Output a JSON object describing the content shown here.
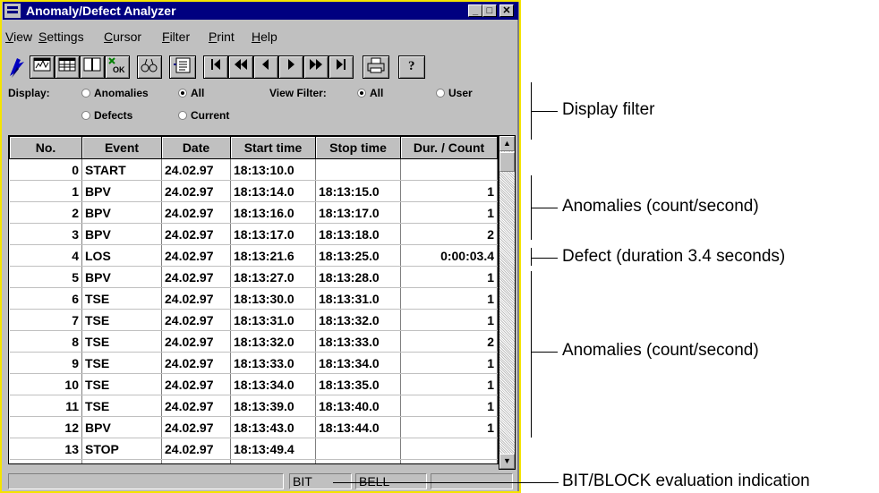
{
  "window": {
    "title": "Anomaly/Defect Analyzer"
  },
  "title_buttons": [
    "_",
    "□",
    "✕"
  ],
  "menu": [
    "View",
    "Settings",
    "Cursor",
    "Filter",
    "Print",
    "Help"
  ],
  "toolbar": {
    "icons": [
      "app-logo-icon",
      "chart-icon",
      "table-icon",
      "split-view-icon",
      "ok-icon",
      "find-icon",
      "list-icon",
      "first-icon",
      "rewind-icon",
      "prev-icon",
      "next-icon",
      "fast-forward-icon",
      "last-icon",
      "print-icon",
      "help-icon"
    ]
  },
  "filter": {
    "display_label": "Display:",
    "view_filter_label": "View Filter:",
    "display_options": [
      {
        "label": "Anomalies",
        "checked": false
      },
      {
        "label": "All",
        "checked": true
      },
      {
        "label": "Defects",
        "checked": false
      },
      {
        "label": "Current",
        "checked": false
      }
    ],
    "view_options": [
      {
        "label": "All",
        "checked": true
      },
      {
        "label": "User",
        "checked": false
      }
    ]
  },
  "table": {
    "columns": [
      "No.",
      "Event",
      "Date",
      "Start time",
      "Stop time",
      "Dur. / Count"
    ],
    "rows": [
      [
        "0",
        "START",
        "24.02.97",
        "18:13:10.0",
        "",
        ""
      ],
      [
        "1",
        "BPV",
        "24.02.97",
        "18:13:14.0",
        "18:13:15.0",
        "1"
      ],
      [
        "2",
        "BPV",
        "24.02.97",
        "18:13:16.0",
        "18:13:17.0",
        "1"
      ],
      [
        "3",
        "BPV",
        "24.02.97",
        "18:13:17.0",
        "18:13:18.0",
        "2"
      ],
      [
        "4",
        "LOS",
        "24.02.97",
        "18:13:21.6",
        "18:13:25.0",
        "0:00:03.4"
      ],
      [
        "5",
        "BPV",
        "24.02.97",
        "18:13:27.0",
        "18:13:28.0",
        "1"
      ],
      [
        "6",
        "TSE",
        "24.02.97",
        "18:13:30.0",
        "18:13:31.0",
        "1"
      ],
      [
        "7",
        "TSE",
        "24.02.97",
        "18:13:31.0",
        "18:13:32.0",
        "1"
      ],
      [
        "8",
        "TSE",
        "24.02.97",
        "18:13:32.0",
        "18:13:33.0",
        "2"
      ],
      [
        "9",
        "TSE",
        "24.02.97",
        "18:13:33.0",
        "18:13:34.0",
        "1"
      ],
      [
        "10",
        "TSE",
        "24.02.97",
        "18:13:34.0",
        "18:13:35.0",
        "1"
      ],
      [
        "11",
        "TSE",
        "24.02.97",
        "18:13:39.0",
        "18:13:40.0",
        "1"
      ],
      [
        "12",
        "BPV",
        "24.02.97",
        "18:13:43.0",
        "18:13:44.0",
        "1"
      ],
      [
        "13",
        "STOP",
        "24.02.97",
        "18:13:49.4",
        "",
        ""
      ],
      [
        "",
        "",
        "",
        "",
        "",
        ""
      ]
    ]
  },
  "status": {
    "bit": "BIT",
    "bell": "BELL",
    "empty": ""
  },
  "annotations": {
    "display_filter": "Display filter",
    "anomalies_1": "Anomalies (count/second)",
    "defect": "Defect (duration 3.4 seconds)",
    "anomalies_2": "Anomalies (count/second)",
    "bit_block": "BIT/BLOCK evaluation indication"
  },
  "colors": {
    "titlebar": "#000080",
    "window_border": "#f5e400",
    "face": "#c0c0c0"
  }
}
